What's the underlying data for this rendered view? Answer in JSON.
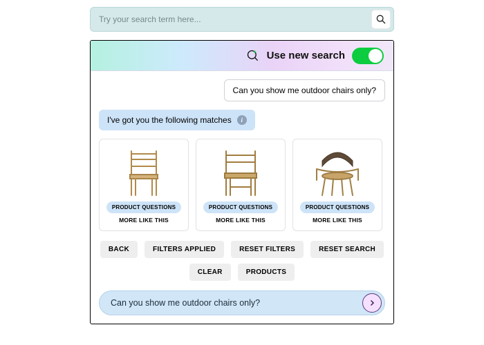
{
  "search": {
    "placeholder": "Try your search term here..."
  },
  "header": {
    "title": "Use new search",
    "toggle_on": true
  },
  "chat": {
    "user_message": "Can you show me outdoor chairs only?",
    "bot_message": "I've got you the following matches"
  },
  "products": [
    {
      "questions_label": "PRODUCT QUESTIONS",
      "more_label": "MORE LIKE THIS"
    },
    {
      "questions_label": "PRODUCT QUESTIONS",
      "more_label": "MORE LIKE THIS"
    },
    {
      "questions_label": "PRODUCT QUESTIONS",
      "more_label": "MORE LIKE THIS"
    }
  ],
  "actions": {
    "row1": [
      "BACK",
      "FILTERS APPLIED",
      "RESET FILTERS",
      "RESET SEARCH"
    ],
    "row2": [
      "CLEAR",
      "PRODUCTS"
    ]
  },
  "footer": {
    "text": "Can you show me outdoor chairs only?"
  }
}
